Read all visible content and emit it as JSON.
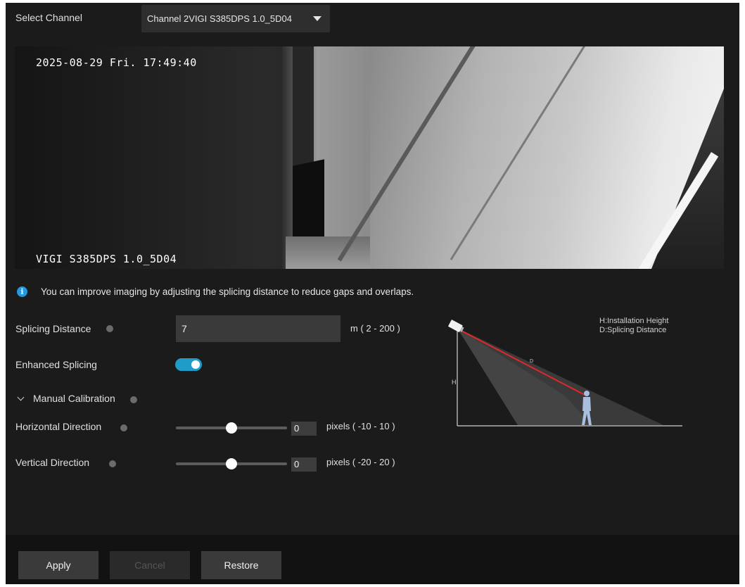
{
  "header": {
    "select_channel_label": "Select Channel",
    "channel_value": "Channel 2VIGI S385DPS 1.0_5D04"
  },
  "video": {
    "timestamp": "2025-08-29 Fri. 17:49:40",
    "model": "VIGI S385DPS 1.0_5D04"
  },
  "tip": {
    "text": "You can improve imaging by adjusting the splicing distance to reduce gaps and overlaps."
  },
  "splicing": {
    "label": "Splicing Distance",
    "value": "7",
    "range": "m ( 2 - 200 )"
  },
  "enhanced": {
    "label": "Enhanced Splicing",
    "enabled": true
  },
  "calibration": {
    "label": "Manual Calibration",
    "horizontal": {
      "label": "Horizontal Direction",
      "value": "0",
      "range": "pixels ( -10 - 10 )",
      "level_fraction": 0.5
    },
    "vertical": {
      "label": "Vertical Direction",
      "value": "0",
      "range": "pixels ( -20 - 20 )",
      "level_fraction": 0.5
    }
  },
  "diagram": {
    "legend_h": "H:Installation Height",
    "legend_d": "D:Splicing Distance",
    "axis_h": "H",
    "axis_d": "D"
  },
  "colors": {
    "accent": "#1f9cc7",
    "info": "#1d9be6",
    "distance_line": "#e02828"
  },
  "footer": {
    "apply": "Apply",
    "cancel": "Cancel",
    "restore": "Restore"
  }
}
